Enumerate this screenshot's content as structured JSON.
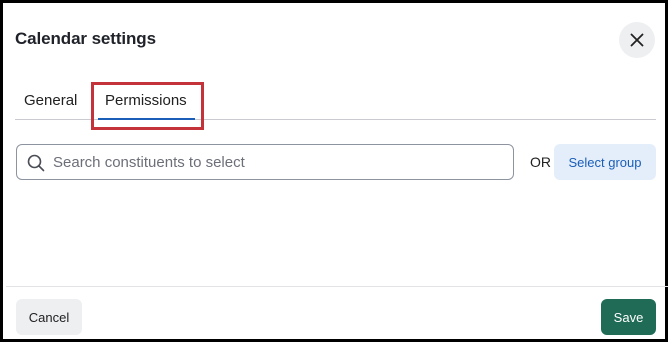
{
  "dialog": {
    "title": "Calendar settings",
    "close_icon": "close-icon"
  },
  "tabs": [
    {
      "label": "General",
      "selected": false
    },
    {
      "label": "Permissions",
      "selected": true
    }
  ],
  "search": {
    "placeholder": "Search constituents to select",
    "value": "",
    "icon": "search-icon"
  },
  "or_label": "OR",
  "select_group_label": "Select group",
  "footer": {
    "cancel_label": "Cancel",
    "save_label": "Save"
  },
  "colors": {
    "accent": "#1a5eb8",
    "save_button": "#1f6b56",
    "highlight": "#c4323a"
  }
}
